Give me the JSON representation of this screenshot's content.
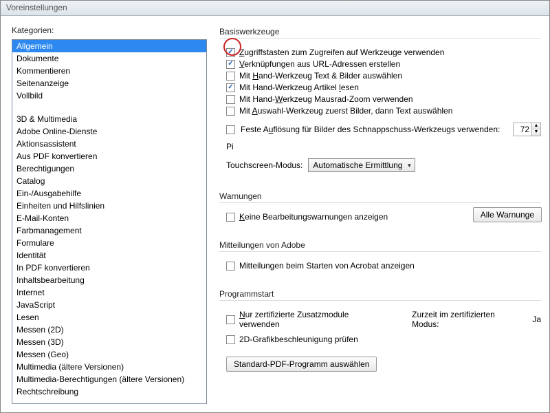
{
  "window": {
    "title": "Voreinstellungen"
  },
  "left": {
    "label": "Kategorien:",
    "selected": "Allgemein",
    "items_top": [
      "Allgemein",
      "Dokumente",
      "Kommentieren",
      "Seitenanzeige",
      "Vollbild"
    ],
    "items_more": [
      "3D & Multimedia",
      "Adobe Online-Dienste",
      "Aktionsassistent",
      "Aus PDF konvertieren",
      "Berechtigungen",
      "Catalog",
      "Ein-/Ausgabehilfe",
      "Einheiten und Hilfslinien",
      "E-Mail-Konten",
      "Farbmanagement",
      "Formulare",
      "Identität",
      "In PDF konvertieren",
      "Inhaltsbearbeitung",
      "Internet",
      "JavaScript",
      "Lesen",
      "Messen (2D)",
      "Messen (3D)",
      "Messen (Geo)",
      "Multimedia (ältere Versionen)",
      "Multimedia-Berechtigungen (ältere Versionen)",
      "Rechtschreibung"
    ]
  },
  "basic": {
    "title": "Basiswerkzeuge",
    "chk1": {
      "checked": true,
      "label_pre": "",
      "u": "Z",
      "label_post": "ugriffstasten zum Zugreifen auf Werkzeuge verwenden"
    },
    "chk2": {
      "checked": true,
      "label_pre": "",
      "u": "V",
      "label_post": "erknüpfungen aus URL-Adressen erstellen"
    },
    "chk3": {
      "checked": false,
      "label_pre": "Mit ",
      "u": "H",
      "label_post": "and-Werkzeug Text & Bilder auswählen"
    },
    "chk4": {
      "checked": true,
      "label_pre": "Mit Hand-Werkzeug Artikel ",
      "u": "l",
      "label_post": "esen"
    },
    "chk5": {
      "checked": false,
      "label_pre": "Mit Hand-",
      "u": "W",
      "label_post": "erkzeug Mausrad-Zoom verwenden"
    },
    "chk6": {
      "checked": false,
      "label_pre": "Mit ",
      "u": "A",
      "label_post": "uswahl-Werkzeug zuerst Bilder, dann Text auswählen"
    },
    "chk7": {
      "checked": false,
      "label_pre": "Feste A",
      "u": "u",
      "label_post": "flösung für Bilder des Schnappschuss-Werkzeugs verwenden:"
    },
    "res_value": "72",
    "res_unit": "Pi",
    "touch_label": "Touchscreen-Modus:",
    "touch_value": "Automatische Ermittlung"
  },
  "warn": {
    "title": "Warnungen",
    "chk": {
      "checked": false,
      "u": "K",
      "label_post": "eine Bearbeitungswarnungen anzeigen"
    },
    "btn": "Alle Warnunge"
  },
  "notices": {
    "title": "Mitteilungen von Adobe",
    "chk": {
      "checked": false,
      "label": "Mitteilungen beim Starten von Acrobat anzeigen"
    }
  },
  "startup": {
    "title": "Programmstart",
    "chk1": {
      "checked": false,
      "u": "N",
      "label_post": "ur zertifizierte Zusatzmodule verwenden"
    },
    "status_label": "Zurzeit im zertifizierten Modus:",
    "status_value": "Ja",
    "chk2": {
      "checked": false,
      "label": "2D-Grafikbeschleunigung prüfen"
    },
    "btn": "Standard-PDF-Programm auswählen"
  }
}
